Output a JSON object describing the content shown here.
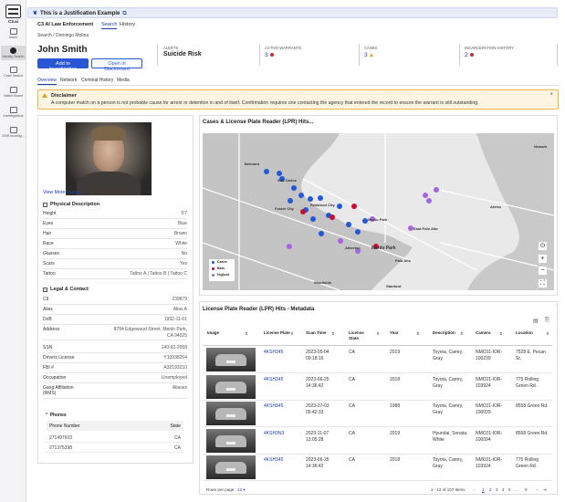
{
  "rail": {
    "logo": "C3.ai",
    "items": [
      {
        "label": "Home",
        "icon": "home-icon"
      },
      {
        "label": "Identity Search",
        "icon": "person-icon"
      },
      {
        "label": "Case Search",
        "icon": "folder-icon"
      },
      {
        "label": "Watch Board",
        "icon": "network-icon"
      },
      {
        "label": "Investigations",
        "icon": "briefcase-icon"
      },
      {
        "label": "DNR Investig...",
        "icon": "document-icon"
      }
    ]
  },
  "banner": {
    "text": "This is a Justification Example"
  },
  "app": {
    "agency": "C3 AI Law Enforcement",
    "tabs": [
      "Search",
      "History"
    ],
    "breadcrumb": "Search  /  Domingo Molina"
  },
  "person": {
    "name": "John Smith",
    "add_button": "Add to Investigation",
    "open_button": "Open in Blackboard"
  },
  "summary": {
    "alerts_label": "ALERTS",
    "alerts_value": "Suicide Risk",
    "warrants_label": "ACTIVE WARRANTS",
    "warrants_count": "3",
    "cases_label": "CASES",
    "cases_count": "3",
    "incarceration_label": "INCARCERATION HISTORY",
    "incarceration_count": "2",
    "colors": {
      "red": "#d3263d",
      "warning": "#e8a21c",
      "link": "#1a3ea8"
    }
  },
  "profile_tabs": [
    "Overview",
    "Network",
    "Criminal History",
    "Media"
  ],
  "disclaimer": {
    "title": "Disclaimer",
    "body": "A computer match on a person is not probable cause for arrest or detention in and of itself. Confirmation requires one contacting the agency that entered the record to ensure the warrant is still outstanding."
  },
  "left_panel": {
    "view_more": "View More Images",
    "physical_title": "Physical Description",
    "physical": [
      {
        "k": "Height",
        "v": "5'7"
      },
      {
        "k": "Eyes",
        "v": "Blue"
      },
      {
        "k": "Hair",
        "v": "Brown"
      },
      {
        "k": "Race",
        "v": "White"
      },
      {
        "k": "Glasses",
        "v": "No"
      },
      {
        "k": "Scars",
        "v": "Yes"
      },
      {
        "k": "Tattoo",
        "v": "Tattoo A | Tattoo B | Tattoo C"
      }
    ],
    "legal_title": "Legal & Contact",
    "legal": [
      {
        "k": "CII",
        "v": "239879"
      },
      {
        "k": "Alias",
        "v": "Alias A"
      },
      {
        "k": "DoB",
        "v": "1992-11-01"
      },
      {
        "k": "Address",
        "v": "8784 Edgewood Street, Menlo Park, CA 94025"
      },
      {
        "k": "SSN",
        "v": "140-92-2058"
      },
      {
        "k": "Drivers License",
        "v": "Y10938204"
      },
      {
        "k": "FBI #",
        "v": "A32193210"
      },
      {
        "k": "Occupation",
        "v": "Unemployed"
      },
      {
        "k": "Gang Affiliation (RMS)",
        "v": "Aliases"
      }
    ],
    "phones_title": "Phones",
    "phone_headers": [
      "Phone Number",
      "State"
    ],
    "phones": [
      {
        "n": "271497603",
        "s": "CA"
      },
      {
        "n": "271375398",
        "s": "CA"
      }
    ]
  },
  "map": {
    "title": "Cases & License Plate Reader (LPR) Hits...",
    "labels": [
      "Newark",
      "Belmont",
      "San Carlos",
      "Redwood City",
      "Foster City",
      "Menlo Park",
      "East Palo Alto",
      "Atherton",
      "Menlo Park",
      "Palo Alto",
      "Woodside",
      "Stanford",
      "Alviso"
    ],
    "legend": [
      "Cases",
      "Bars",
      "Highest"
    ],
    "legend_colors": [
      "#2159d6",
      "#c8102e",
      "#a466e0"
    ],
    "controls": [
      "⊙",
      "+",
      "−",
      "⛶"
    ]
  },
  "lpr": {
    "title": "License Plate Reader (LPR) Hits - Metadata",
    "columns": [
      "Image",
      "License Plate",
      "Scan Time",
      "License State",
      "Year",
      "Description",
      "Camera",
      "Location"
    ],
    "rows": [
      {
        "plate": "4KSH345",
        "time": "2023-05-04 09:18:16",
        "state": "CA",
        "year": "2019",
        "desc": "Toyota, Camry, Gray",
        "camera": "NMC01-IOR-100239",
        "loc": "7528 E. Pecan St."
      },
      {
        "plate": "4KSH345",
        "time": "2023-06-25 14:36:42",
        "state": "CA",
        "year": "2018",
        "desc": "Toyota, Camry, Gray",
        "camera": "NMC01-IOR-103924",
        "loc": "775 Rolling Green Rd."
      },
      {
        "plate": "4KSH345",
        "time": "2023-07-03 05:42:33",
        "state": "CA",
        "year": "1988",
        "desc": "Toyota, Camry, Gray",
        "camera": "NMC01-IOR-100029",
        "loc": "8558 Green Rd."
      },
      {
        "plate": "4KSH3N3",
        "time": "2023-11-07 13:05:28",
        "state": "CA",
        "year": "2019",
        "desc": "Hyundai, Sonata, White",
        "camera": "NMC01-IOR-100094",
        "loc": "8558 Green Rd."
      },
      {
        "plate": "4KSH345",
        "time": "2023-06-25 14:36:42",
        "state": "CA",
        "year": "2018",
        "desc": "Toyota, Camry, Gray",
        "camera": "NMC01-IOR-103924",
        "loc": "775 Rolling Green Rd."
      }
    ],
    "rows_per_page_label": "Rows per page:",
    "rows_per_page": "12",
    "range": "1 - 12 of 107 Items",
    "pages": [
      "1",
      "2",
      "3",
      "4",
      "5",
      "...",
      "9"
    ]
  }
}
